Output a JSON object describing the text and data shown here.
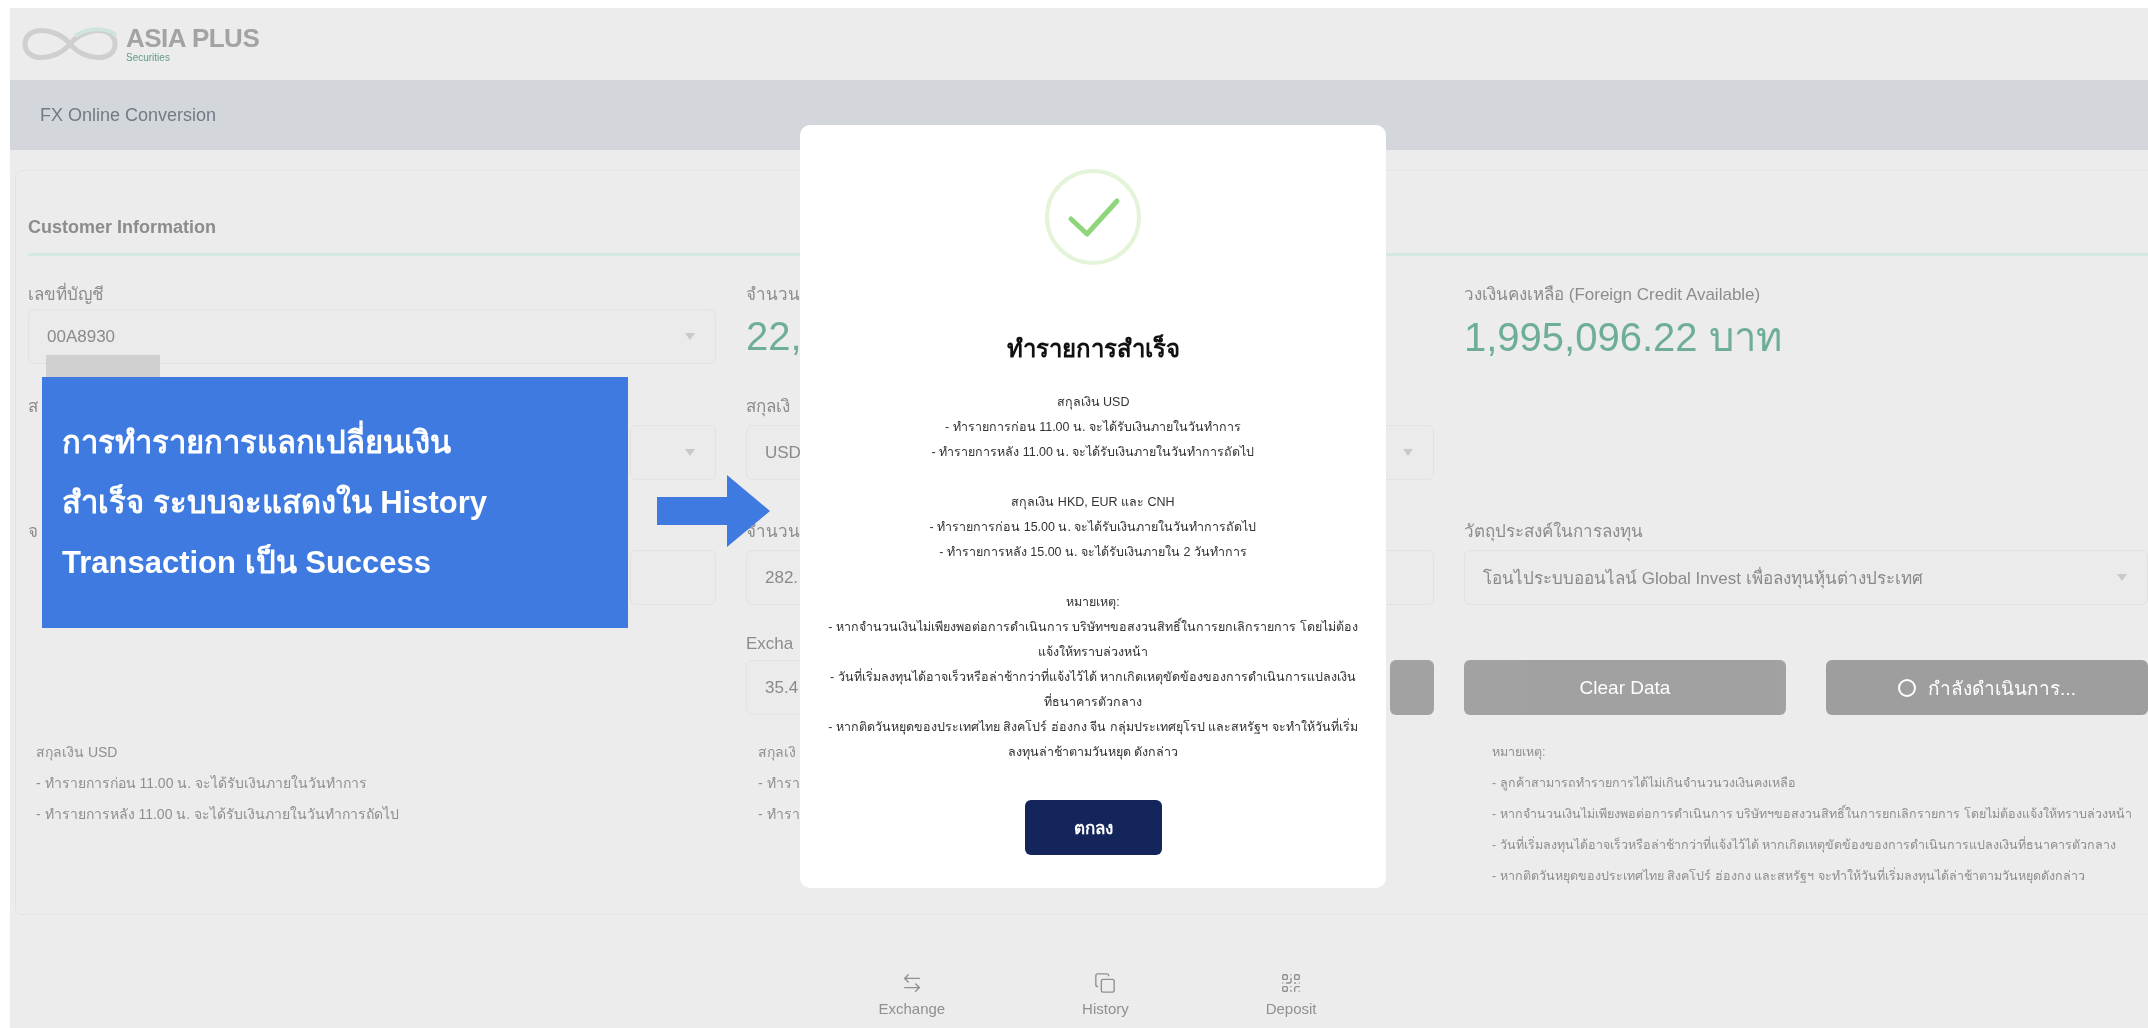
{
  "brand": {
    "name": "ASIA PLUS",
    "tagline": "Securities"
  },
  "page_title": "FX Online Conversion",
  "section_title": "Customer Information",
  "left": {
    "account_label": "เลขที่บัญชี",
    "account_value": "00A8930",
    "currency_label": "ส",
    "amount_label": "จ",
    "notes": [
      "สกุลเงิน USD",
      "- ทำรายการก่อน 11.00 น. จะได้รับเงินภายในวันทำการ",
      "- ทำรายการหลัง 11.00 น. จะได้รับเงินภายในวันทำการถัดไป"
    ]
  },
  "middle": {
    "balance_label": "จำนวน",
    "balance_value": "22,",
    "currency_label": "สกุลเงิ",
    "currency_value": "USD",
    "amount_label": "จำนวน",
    "amount_value": "282.",
    "rate_label": "Excha",
    "rate_value": "35.4",
    "notes": [
      "สกุลเงิ",
      "- ทำรา",
      "- ทำรา"
    ]
  },
  "right": {
    "credit_label": "วงเงินคงเหลือ (Foreign Credit Available)",
    "credit_value": "1,995,096.22 บาท",
    "purpose_label": "วัตถุประสงค์ในการลงทุน",
    "purpose_value": "โอนไประบบออนไลน์ Global Invest เพื่อลงทุนหุ้นต่างประเทศ",
    "clear_button": "Clear Data",
    "processing_button": {
      "label": "กำลังดำเนินการ...",
      "disabled": true
    },
    "notes_title": "หมายเหตุ:",
    "notes": [
      "- ลูกค้าสามารถทำรายการได้ไม่เกินจำนวนวงเงินคงเหลือ",
      "- หากจำนวนเงินไม่เพียงพอต่อการดำเนินการ บริษัทฯขอสงวนสิทธิ์ในการยกเลิกรายการ โดยไม่ต้องแจ้งให้ทราบล่วงหน้า",
      "- วันที่เริ่มลงทุนได้อาจเร็วหรือล่าช้ากว่าที่แจ้งไว้ได้ หากเกิดเหตุขัดข้องของการดำเนินการแปลงเงินที่ธนาคารตัวกลาง",
      "- หากติดวันหยุดของประเทศไทย สิงคโปร์ ฮ่องกง และสหรัฐฯ จะทำให้วันที่เริ่มลงทุนได้ล่าช้าตามวันหยุดดังกล่าว"
    ]
  },
  "bottom_nav": [
    {
      "label": "Exchange",
      "selected": false
    },
    {
      "label": "History",
      "selected": false
    },
    {
      "label": "Deposit",
      "selected": false
    }
  ],
  "modal": {
    "title": "ทำรายการสำเร็จ",
    "sections": [
      {
        "heading": "สกุลเงิน USD",
        "lines": [
          "- ทำรายการก่อน 11.00 น. จะได้รับเงินภายในวันทำการ",
          "- ทำรายการหลัง 11.00 น. จะได้รับเงินภายในวันทำการถัดไป"
        ]
      },
      {
        "heading": "สกุลเงิน HKD, EUR และ CNH",
        "lines": [
          "- ทำรายการก่อน 15.00 น. จะได้รับเงินภายในวันทำการถัดไป",
          "- ทำรายการหลัง 15.00 น. จะได้รับเงินภายใน 2 วันทำการ"
        ]
      },
      {
        "heading": "หมายเหตุ:",
        "lines": [
          "- หากจำนวนเงินไม่เพียงพอต่อการดำเนินการ บริษัทฯขอสงวนสิทธิ์ในการยกเลิกรายการ โดยไม่ต้องแจ้งให้ทราบล่วงหน้า",
          "- วันที่เริ่มลงทุนได้อาจเร็วหรือล่าช้ากว่าที่แจ้งไว้ได้ หากเกิดเหตุขัดข้องของการดำเนินการแปลงเงินที่ธนาคารตัวกลาง",
          "- หากติดวันหยุดของประเทศไทย สิงคโปร์ ฮ่องกง จีน กลุ่มประเทศยุโรป และสหรัฐฯ จะทำให้วันที่เริ่มลงทุนล่าช้าตามวันหยุด ดังกล่าว"
        ]
      }
    ],
    "button": "ตกลง"
  },
  "callout": {
    "lines": [
      "การทำรายการแลกเปลี่ยนเงิน",
      "สำเร็จ ระบบจะแสดงใน History",
      "Transaction เป็น Success"
    ]
  }
}
